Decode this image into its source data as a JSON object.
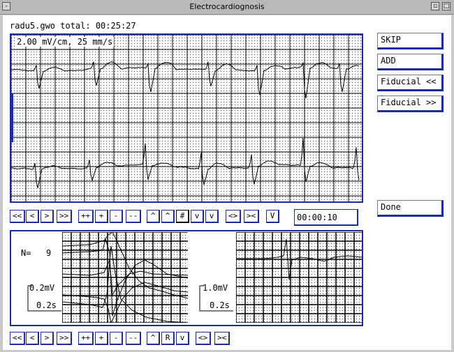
{
  "window": {
    "title": "Electrocardiognosis"
  },
  "header": {
    "file_info": "radu5.gwo total: 00:25:27"
  },
  "ecg": {
    "scale_label": "2.00 mV/cm, 25 mm/s"
  },
  "side_buttons": {
    "skip": "SKIP",
    "add": "ADD",
    "fiducial_prev": "Fiducial <<",
    "fiducial_next": "Fiducial >>",
    "done": "Done"
  },
  "nav_top": [
    "<<",
    "<",
    ">",
    ">>",
    "++",
    "+",
    "-",
    "--",
    "^",
    "^",
    "#",
    "v",
    "v",
    "<>",
    "><",
    "V"
  ],
  "time_display": "00:00:10",
  "beat_panel": {
    "count_label": "N=",
    "count_value": "9",
    "left_amp": "0.2mV",
    "left_time": "0.2s",
    "right_amp": "1.0mV",
    "right_time": "0.2s"
  },
  "nav_bottom": [
    "<<",
    "<",
    ">",
    ">>",
    "++",
    "+",
    "-",
    "--",
    "^",
    "R",
    "v",
    "<>",
    "><"
  ]
}
